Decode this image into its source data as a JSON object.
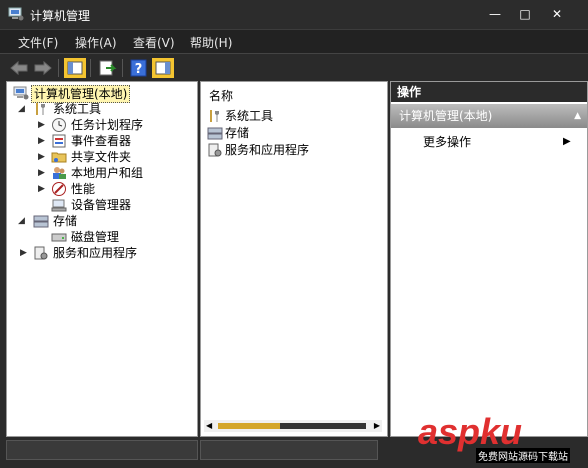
{
  "window": {
    "title": "计算机管理",
    "minimize": "—",
    "maximize": "□",
    "close": "✕"
  },
  "menu": [
    {
      "label": "文件(F)"
    },
    {
      "label": "操作(A)"
    },
    {
      "label": "查看(V)"
    },
    {
      "label": "帮助(H)"
    }
  ],
  "toolbar": {
    "icons": [
      "back-arrow-icon",
      "forward-arrow-icon",
      "show-hide-console-tree-icon",
      "export-list-icon",
      "help-icon",
      "show-hide-action-pane-icon"
    ]
  },
  "tree": {
    "root": "计算机管理(本地)",
    "items": [
      {
        "label": "系统工具",
        "expanded": true
      },
      {
        "label": "任务计划程序"
      },
      {
        "label": "事件查看器"
      },
      {
        "label": "共享文件夹"
      },
      {
        "label": "本地用户和组"
      },
      {
        "label": "性能"
      },
      {
        "label": "设备管理器"
      },
      {
        "label": "存储",
        "expanded": true
      },
      {
        "label": "磁盘管理"
      },
      {
        "label": "服务和应用程序"
      }
    ]
  },
  "list": {
    "header": "名称",
    "items": [
      {
        "label": "系统工具"
      },
      {
        "label": "存储"
      },
      {
        "label": "服务和应用程序"
      }
    ]
  },
  "actions": {
    "header": "操作",
    "section": "计算机管理(本地)",
    "more": "更多操作"
  },
  "watermark": {
    "brand": "aspku",
    "tagline": "免费网站源码下载站"
  }
}
